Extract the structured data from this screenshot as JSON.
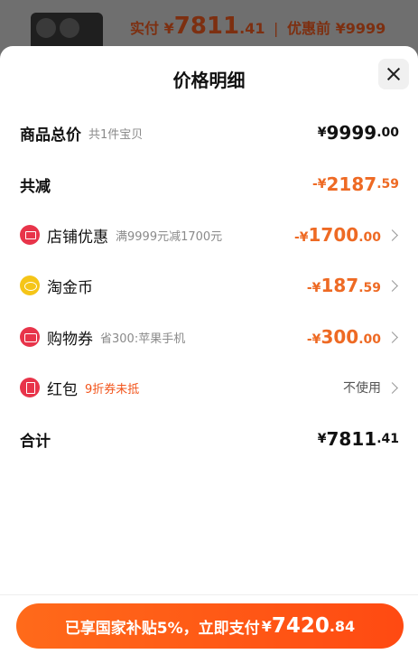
{
  "background": {
    "actual_label": "实付",
    "actual_currency": "¥",
    "actual_int": "7811",
    "actual_dec": ".41",
    "separator": "|",
    "before_label": "优惠前",
    "before_amount": "¥9999"
  },
  "sheet": {
    "title": "价格明细",
    "rows": {
      "total_goods": {
        "label": "商品总价",
        "sub": "共1件宝贝",
        "currency": "¥",
        "int": "9999",
        "dec": ".00"
      },
      "total_reduction": {
        "label": "共减",
        "currency": "-¥",
        "int": "2187",
        "dec": ".59"
      },
      "store_discount": {
        "label": "店铺优惠",
        "sub": "满9999元减1700元",
        "currency": "-¥",
        "int": "1700",
        "dec": ".00"
      },
      "taojinbi": {
        "label": "淘金币",
        "currency": "-¥",
        "int": "187",
        "dec": ".59"
      },
      "voucher": {
        "label": "购物券",
        "sub": "省300:苹果手机",
        "currency": "-¥",
        "int": "300",
        "dec": ".00"
      },
      "redpacket": {
        "label": "红包",
        "sub": "9折券未抵",
        "status": "不使用"
      },
      "total": {
        "label": "合计",
        "currency": "¥",
        "int": "7811",
        "dec": ".41"
      }
    }
  },
  "pay_button": {
    "text": "已享国家补贴5%，立即支付",
    "currency": "¥",
    "int": "7420",
    "dec": ".84"
  },
  "colors": {
    "accent": "#ff5a14",
    "discount": "#ee6a24",
    "subsidy_note": "#f2541b",
    "icon_red": "#e8344a",
    "icon_gold": "#f5c518"
  },
  "icons": [
    "store-icon",
    "coin-icon",
    "voucher-icon",
    "red-packet-icon",
    "close-icon",
    "chevron-right-icon"
  ]
}
